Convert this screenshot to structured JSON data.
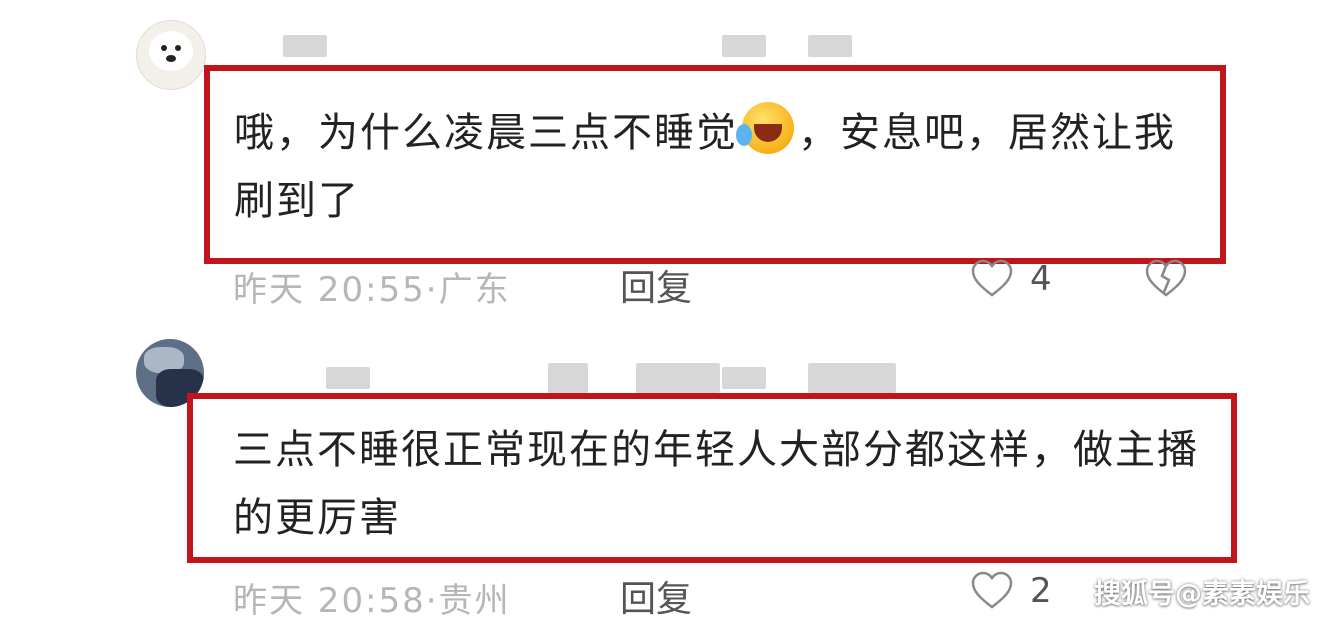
{
  "comments": [
    {
      "text_part1": "哦，为什么凌晨三点不睡觉",
      "emoji": "rolling-on-floor-laughing-emoji",
      "text_part2": "，安息吧，居然让我刷到了",
      "time_location": "昨天 20:55·广东",
      "reply_label": "回复",
      "likes": "4"
    },
    {
      "text": "三点不睡很正常现在的年轻人大部分都这样，做主播的更厉害",
      "time_location": "昨天 20:58·贵州",
      "reply_label": "回复",
      "likes": "2"
    }
  ],
  "watermark": "搜狐号@素素娱乐",
  "colors": {
    "highlight_border": "#c2141b",
    "meta_text": "#b6b6b6",
    "body_text": "#222222"
  }
}
